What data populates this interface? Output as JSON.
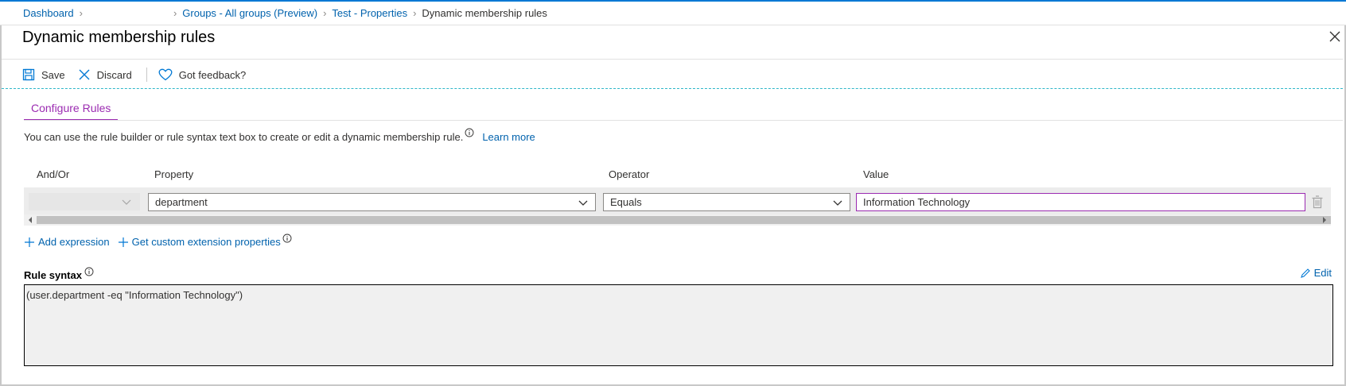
{
  "breadcrumb": {
    "items": [
      "Dashboard",
      "Groups - All groups (Preview)",
      "Test - Properties"
    ],
    "current": "Dynamic membership rules"
  },
  "blade": {
    "title": "Dynamic membership rules"
  },
  "toolbar": {
    "save_label": "Save",
    "discard_label": "Discard",
    "feedback_label": "Got feedback?"
  },
  "tabs": [
    {
      "label": "Configure Rules",
      "active": true
    }
  ],
  "description": {
    "text": "You can use the rule builder or rule syntax text box to create or edit a dynamic membership rule.",
    "learn_more": "Learn more"
  },
  "rule_builder": {
    "headers": {
      "and_or": "And/Or",
      "property": "Property",
      "operator": "Operator",
      "value": "Value"
    },
    "rows": [
      {
        "and_or": "",
        "property": "department",
        "operator": "Equals",
        "value": "Information Technology"
      }
    ],
    "add_expression": "Add expression",
    "custom_extension": "Get custom extension properties"
  },
  "rule_syntax": {
    "label": "Rule syntax",
    "edit_label": "Edit",
    "text": "(user.department -eq \"Information Technology\")"
  },
  "colors": {
    "link": "#0062ad",
    "accent_tab": "#9b2bb1",
    "top_bar": "#0078d4"
  },
  "icons": [
    "chevron-right-icon",
    "close-icon",
    "save-icon",
    "discard-icon",
    "heart-icon",
    "info-icon",
    "chevron-down-icon",
    "trash-icon",
    "plus-icon",
    "pencil-icon"
  ]
}
